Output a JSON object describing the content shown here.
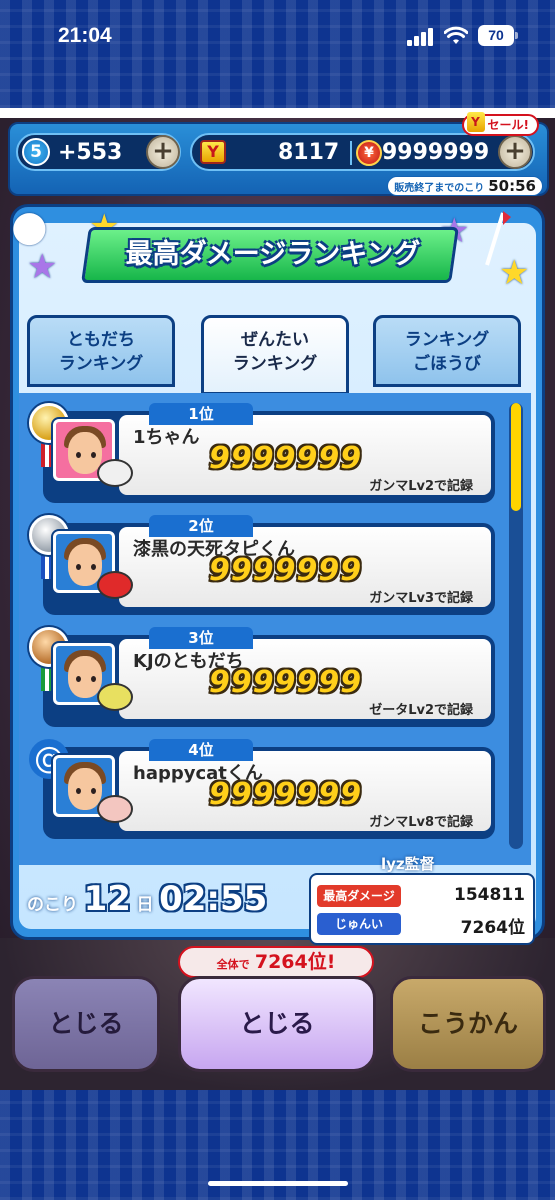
{
  "status_bar": {
    "time": "21:04",
    "battery": "70"
  },
  "top_bar": {
    "level": "5",
    "level_value": "+553",
    "coins": "8117",
    "y_money": "9999999",
    "sale_label": "セール!",
    "sale_timer_label": "販売終了までのこり",
    "sale_timer_value": "50:56"
  },
  "panel": {
    "title": "最高ダメージランキング",
    "tabs": [
      {
        "line1": "ともだち",
        "line2": "ランキング"
      },
      {
        "line1": "ぜんたい",
        "line2": "ランキング"
      },
      {
        "line1": "ランキング",
        "line2": "ごほうび"
      }
    ],
    "entries": [
      {
        "rank": "1位",
        "name": "1ちゃん",
        "score": "9999999",
        "record": "ガンマLv2で記録"
      },
      {
        "rank": "2位",
        "name": "漆黒の天死タピくん",
        "score": "9999999",
        "record": "ガンマLv3で記録"
      },
      {
        "rank": "3位",
        "name": "KJのともだち",
        "score": "9999999",
        "record": "ゼータLv2で記録"
      },
      {
        "rank": "4位",
        "name": "happycatくん",
        "score": "9999999",
        "record": "ガンマLv8で記録"
      }
    ],
    "countdown": {
      "prefix": "のこり",
      "days": "12",
      "day_unit": "日",
      "time": "02:55"
    },
    "my_record": {
      "name": "lyz監督",
      "damage_label": "最高ダメージ",
      "damage_value": "154811",
      "rank_label": "じゅんい",
      "rank_value": "7264位"
    }
  },
  "background_badge": {
    "prefix": "全体で",
    "value": "7264位!"
  },
  "buttons": {
    "left": "とじる",
    "middle": "とじる",
    "right": "こうかん"
  },
  "colors": {
    "accent_blue": "#2f8fe0",
    "banner_green": "#17b64a",
    "score_yellow": "#ffcf1a"
  }
}
